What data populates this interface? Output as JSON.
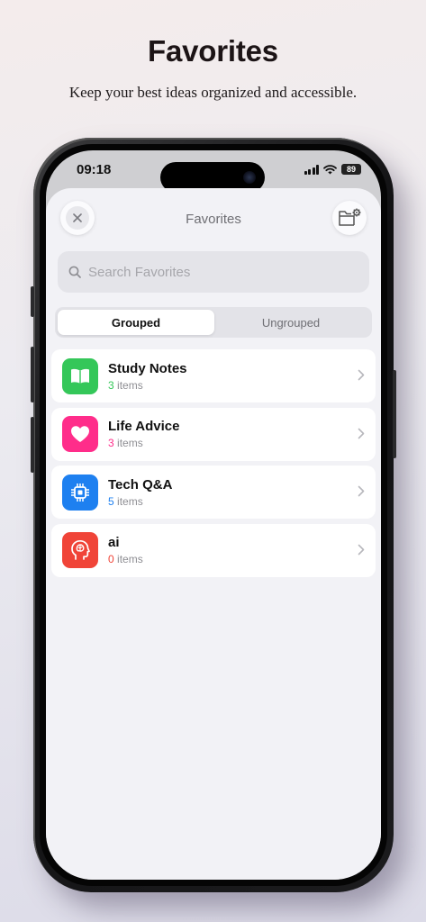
{
  "promo": {
    "title": "Favorites",
    "subtitle": "Keep your best ideas organized and accessible."
  },
  "status_bar": {
    "time": "09:18",
    "battery": "89"
  },
  "sheet": {
    "title": "Favorites",
    "close_icon": "close-icon",
    "folder_settings_icon": "folder-gear-icon"
  },
  "search": {
    "placeholder": "Search Favorites",
    "icon": "search-icon"
  },
  "segments": {
    "grouped": "Grouped",
    "ungrouped": "Ungrouped",
    "selected": "Grouped"
  },
  "groups": [
    {
      "title": "Study Notes",
      "count": "3",
      "count_label": "items",
      "icon": "book-icon",
      "color": "#34c759"
    },
    {
      "title": "Life Advice",
      "count": "3",
      "count_label": "items",
      "icon": "heart-icon",
      "color": "#ff2d8a"
    },
    {
      "title": "Tech Q&A",
      "count": "5",
      "count_label": "items",
      "icon": "chip-icon",
      "color": "#1e80f0"
    },
    {
      "title": "ai",
      "count": "0",
      "count_label": "items",
      "icon": "brain-head-icon",
      "color": "#f04438"
    }
  ]
}
